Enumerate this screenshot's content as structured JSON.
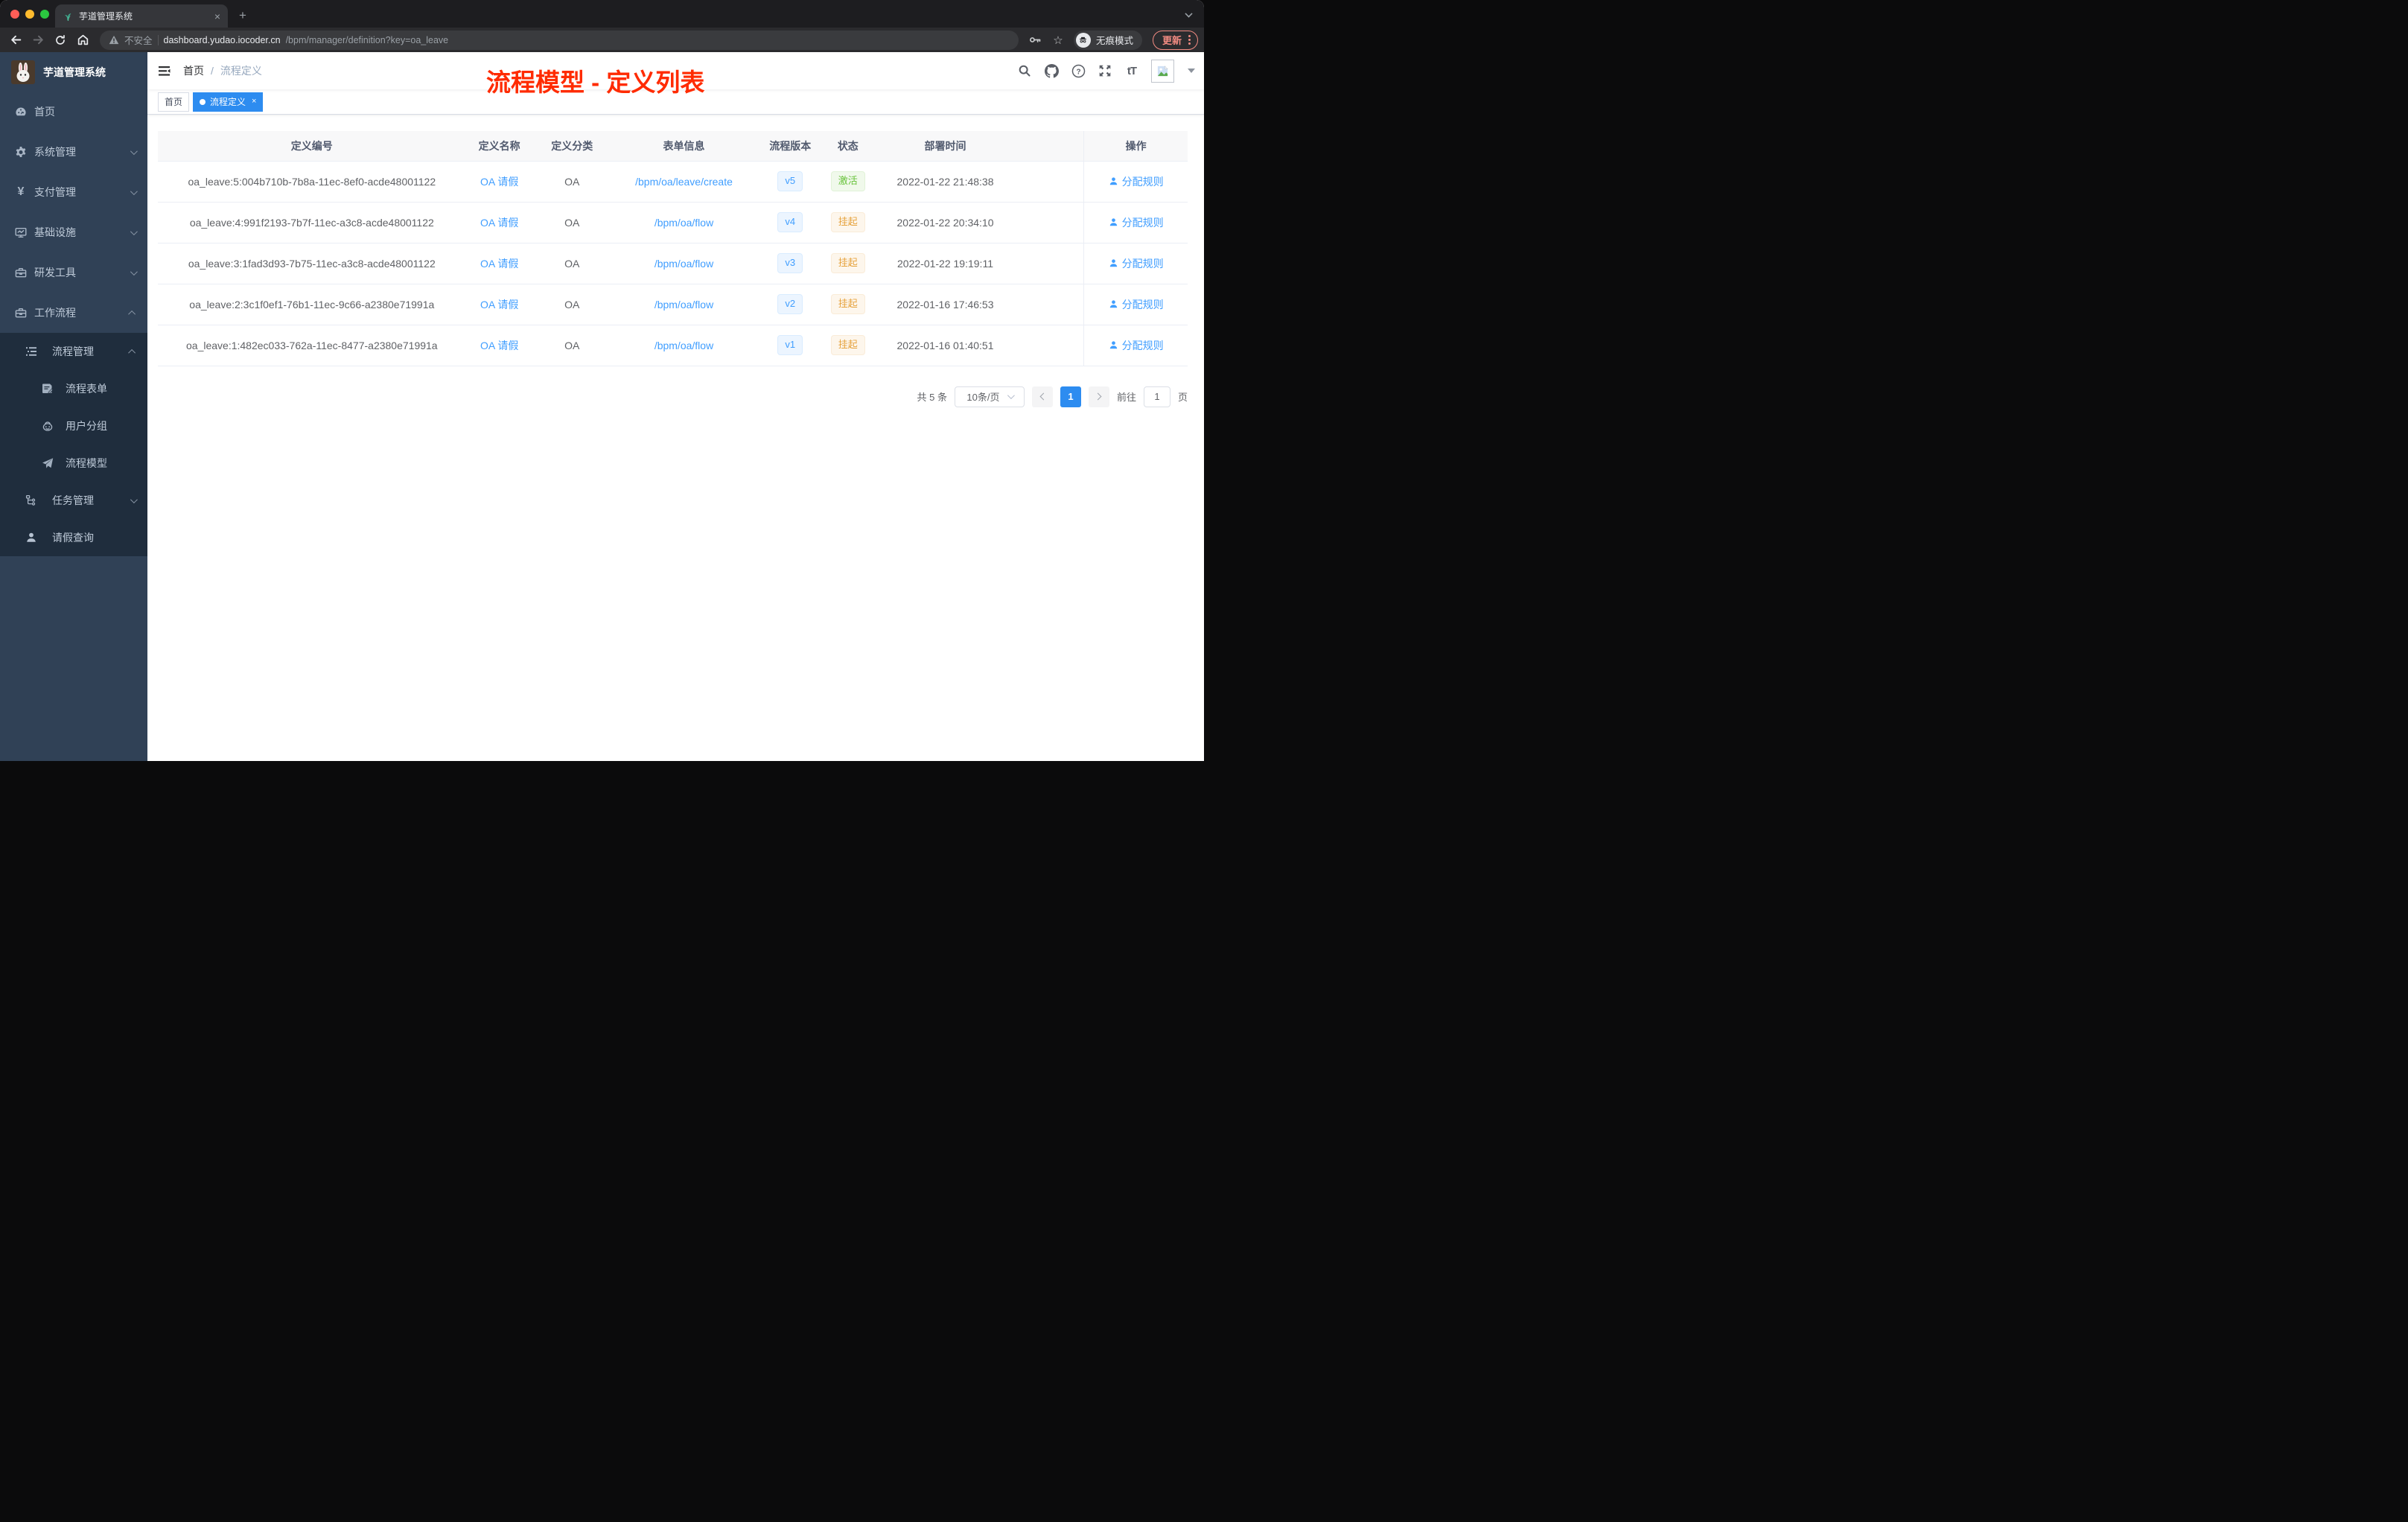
{
  "browser": {
    "tab": {
      "title": "芋道管理系统",
      "close_glyph": "×",
      "favicon": "sprout-icon"
    },
    "new_tab_glyph": "+",
    "address": {
      "security_label": "不安全",
      "host": "dashboard.yudao.iocoder.cn",
      "path": "/bpm/manager/definition?key=oa_leave"
    },
    "incognito_label": "无痕模式",
    "update_label": "更新"
  },
  "sidebar": {
    "title": "芋道管理系统",
    "items": [
      {
        "label": "首页",
        "icon": "dashboard-icon"
      },
      {
        "label": "系统管理",
        "icon": "gear-icon"
      },
      {
        "label": "支付管理",
        "icon": "yen-icon",
        "yen_glyph": "¥"
      },
      {
        "label": "基础设施",
        "icon": "monitor-icon"
      },
      {
        "label": "研发工具",
        "icon": "toolbox-icon"
      },
      {
        "label": "工作流程",
        "icon": "toolbox-icon",
        "expanded": true,
        "children": [
          {
            "label": "流程管理",
            "icon": "list-icon",
            "expanded": true,
            "children": [
              {
                "label": "流程表单",
                "icon": "form-icon"
              },
              {
                "label": "用户分组",
                "icon": "robot-icon"
              },
              {
                "label": "流程模型",
                "icon": "send-icon"
              }
            ]
          },
          {
            "label": "任务管理",
            "icon": "tree-icon"
          },
          {
            "label": "请假查询",
            "icon": "user-icon"
          }
        ]
      }
    ]
  },
  "header": {
    "breadcrumb": {
      "home": "首页",
      "separator": "/",
      "current": "流程定义"
    },
    "font_size_label": "tT",
    "help_glyph": "?",
    "annotation": "流程模型 - 定义列表"
  },
  "tags": [
    {
      "label": "首页",
      "active": false
    },
    {
      "label": "流程定义",
      "active": true,
      "close_glyph": "×"
    }
  ],
  "table": {
    "columns": [
      "定义编号",
      "定义名称",
      "定义分类",
      "表单信息",
      "流程版本",
      "状态",
      "部署时间",
      "操作"
    ],
    "rows": [
      {
        "id": "oa_leave:5:004b710b-7b8a-11ec-8ef0-acde48001122",
        "name": "OA 请假",
        "category": "OA",
        "form": "/bpm/oa/leave/create",
        "version": "v5",
        "status": "激活",
        "status_type": "success",
        "time": "2022-01-22 21:48:38",
        "action": "分配规则"
      },
      {
        "id": "oa_leave:4:991f2193-7b7f-11ec-a3c8-acde48001122",
        "name": "OA 请假",
        "category": "OA",
        "form": "/bpm/oa/flow",
        "version": "v4",
        "status": "挂起",
        "status_type": "warning",
        "time": "2022-01-22 20:34:10",
        "action": "分配规则"
      },
      {
        "id": "oa_leave:3:1fad3d93-7b75-11ec-a3c8-acde48001122",
        "name": "OA 请假",
        "category": "OA",
        "form": "/bpm/oa/flow",
        "version": "v3",
        "status": "挂起",
        "status_type": "warning",
        "time": "2022-01-22 19:19:11",
        "action": "分配规则"
      },
      {
        "id": "oa_leave:2:3c1f0ef1-76b1-11ec-9c66-a2380e71991a",
        "name": "OA 请假",
        "category": "OA",
        "form": "/bpm/oa/flow",
        "version": "v2",
        "status": "挂起",
        "status_type": "warning",
        "time": "2022-01-16 17:46:53",
        "action": "分配规则"
      },
      {
        "id": "oa_leave:1:482ec033-762a-11ec-8477-a2380e71991a",
        "name": "OA 请假",
        "category": "OA",
        "form": "/bpm/oa/flow",
        "version": "v1",
        "status": "挂起",
        "status_type": "warning",
        "time": "2022-01-16 01:40:51",
        "action": "分配规则"
      }
    ]
  },
  "pagination": {
    "total_label": "共 5 条",
    "page_size": "10条/页",
    "current_page": "1",
    "goto_label": "前往",
    "goto_value": "1",
    "unit_label": "页"
  },
  "colors": {
    "accent_blue": "#409EFF",
    "tag_active_blue": "#2D8CF0",
    "success_text": "#67C23A",
    "success_bg": "#F0F9EB",
    "warning_text": "#E6A23C",
    "warning_bg": "#FDF6EC",
    "version_bg": "#ECF5FF",
    "annotation_red": "#FF2B00",
    "sidebar_bg": "#304156",
    "sidebar_submenu_bg": "#1F2D3D",
    "update_coral": "#F28B82"
  }
}
